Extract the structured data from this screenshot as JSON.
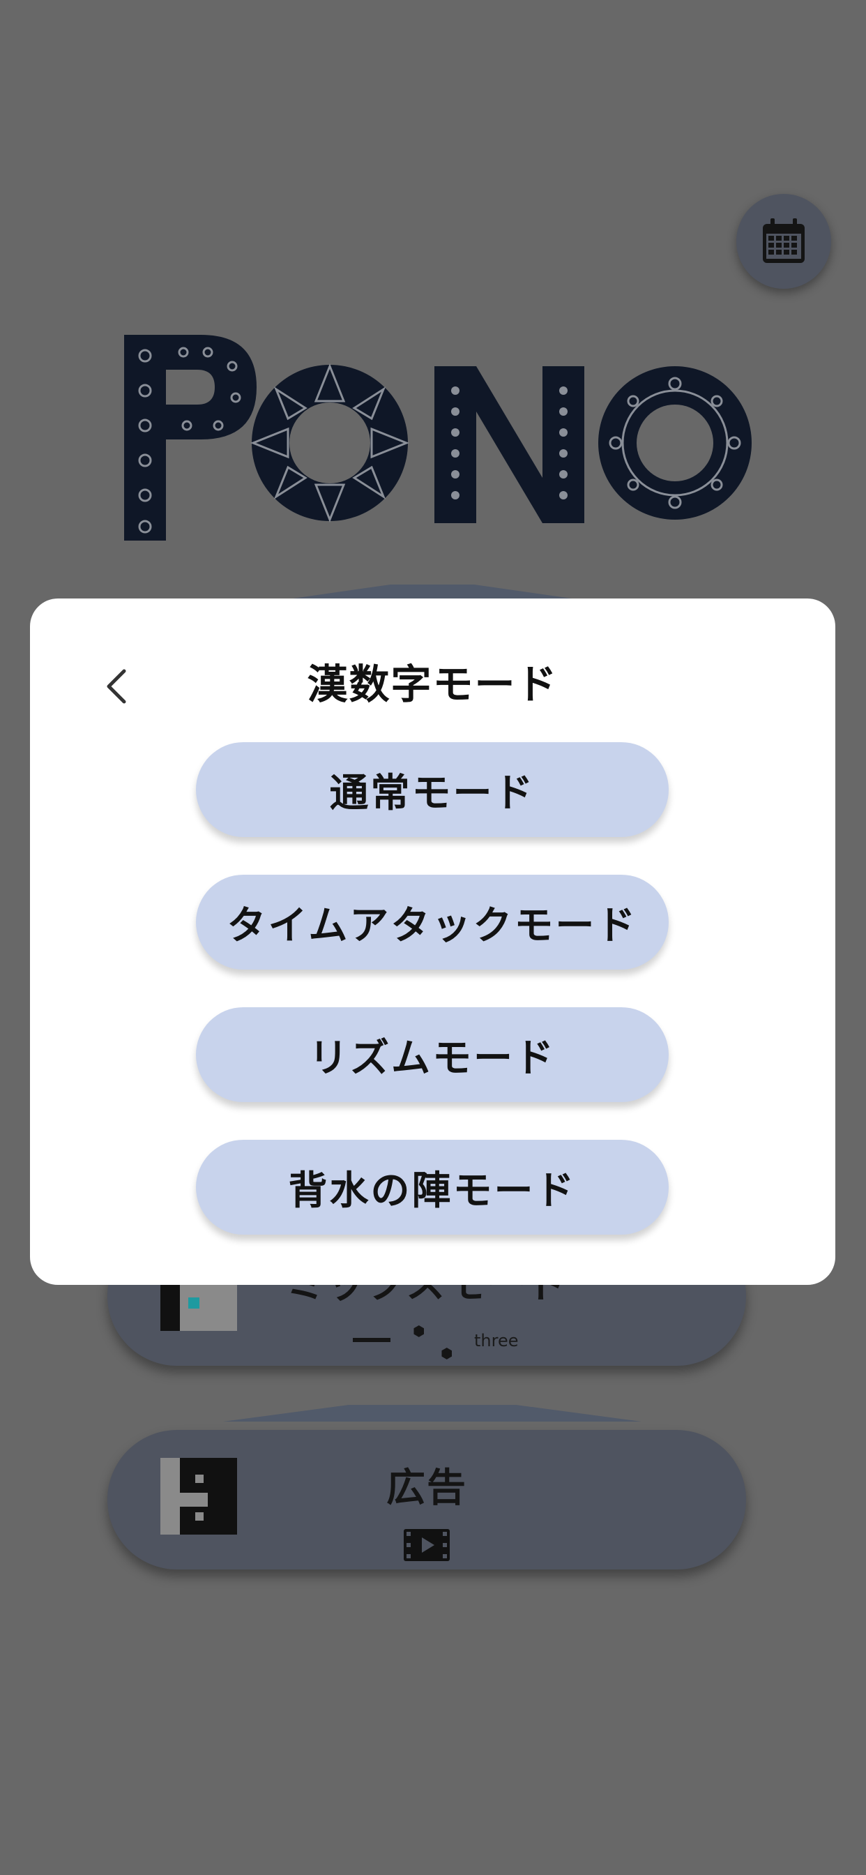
{
  "header": {
    "calendar_icon": "calendar-icon"
  },
  "logo": {
    "text": "PONO"
  },
  "background": {
    "mix_card": {
      "title": "ミックスモード",
      "sub_label": "three"
    },
    "ad_card": {
      "title": "広告",
      "icon": "video-icon"
    }
  },
  "modal": {
    "title": "漢数字モード",
    "back_icon": "chevron-left-icon",
    "buttons": [
      {
        "label": "通常モード"
      },
      {
        "label": "タイムアタックモード"
      },
      {
        "label": "リズムモード"
      },
      {
        "label": "背水の陣モード"
      }
    ]
  },
  "colors": {
    "overlay_bg": "#686868",
    "card_bg": "#4f5460",
    "modal_bg": "#ffffff",
    "button_bg": "#c8d3ec",
    "logo_fill": "#0f1727"
  }
}
